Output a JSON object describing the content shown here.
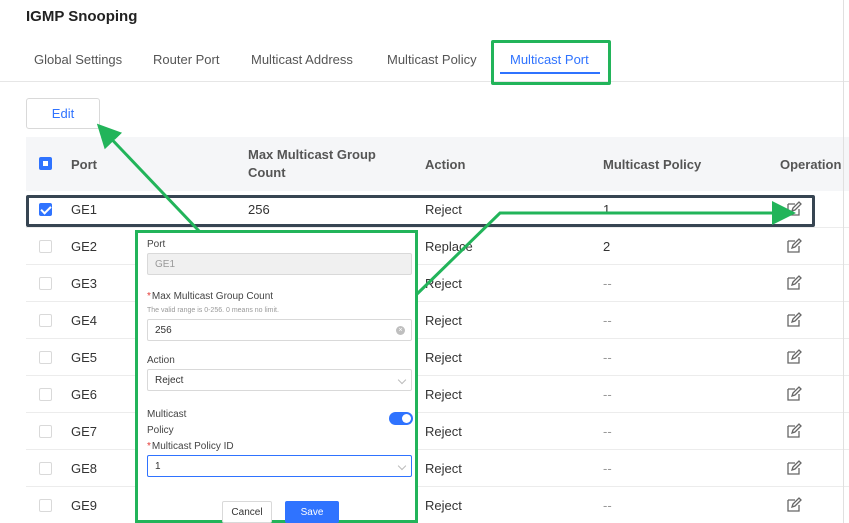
{
  "page": {
    "title": "IGMP Snooping"
  },
  "tabs": [
    {
      "label": "Global Settings",
      "active": false
    },
    {
      "label": "Router Port",
      "active": false
    },
    {
      "label": "Multicast Address",
      "active": false
    },
    {
      "label": "Multicast Policy",
      "active": false
    },
    {
      "label": "Multicast Port",
      "active": true
    }
  ],
  "toolbar": {
    "edit_label": "Edit"
  },
  "table": {
    "headers": {
      "port": "Port",
      "max_group_line1": "Max Multicast Group",
      "max_group_line2": "Count",
      "action": "Action",
      "policy": "Multicast Policy",
      "operation": "Operation"
    },
    "rows": [
      {
        "port": "GE1",
        "max": "256",
        "action": "Reject",
        "policy": "1",
        "checked": true
      },
      {
        "port": "GE2",
        "max": "",
        "action": "Replace",
        "policy": "2",
        "checked": false
      },
      {
        "port": "GE3",
        "max": "",
        "action": "Reject",
        "policy": "--",
        "checked": false
      },
      {
        "port": "GE4",
        "max": "",
        "action": "Reject",
        "policy": "--",
        "checked": false
      },
      {
        "port": "GE5",
        "max": "",
        "action": "Reject",
        "policy": "--",
        "checked": false
      },
      {
        "port": "GE6",
        "max": "",
        "action": "Reject",
        "policy": "--",
        "checked": false
      },
      {
        "port": "GE7",
        "max": "",
        "action": "Reject",
        "policy": "--",
        "checked": false
      },
      {
        "port": "GE8",
        "max": "",
        "action": "Reject",
        "policy": "--",
        "checked": false
      },
      {
        "port": "GE9",
        "max": "",
        "action": "Reject",
        "policy": "--",
        "checked": false
      }
    ]
  },
  "edit_panel": {
    "port_label": "Port",
    "port_value": "GE1",
    "max_label": "Max Multicast Group Count",
    "max_hint": "The valid range is 0-256. 0 means no limit.",
    "max_value": "256",
    "action_label": "Action",
    "action_value": "Reject",
    "policy_toggle_label_line1": "Multicast",
    "policy_toggle_label_line2": "Policy",
    "policy_toggle_on": true,
    "policy_id_label": "Multicast Policy ID",
    "policy_id_value": "1",
    "cancel_label": "Cancel",
    "save_label": "Save"
  },
  "colors": {
    "accent": "#2f73ff",
    "highlight_green": "#22b45a",
    "highlight_dark": "#374552"
  },
  "icons": {
    "edit": "edit-icon",
    "clear": "clear-icon",
    "dropdown": "chevron-down-icon"
  }
}
